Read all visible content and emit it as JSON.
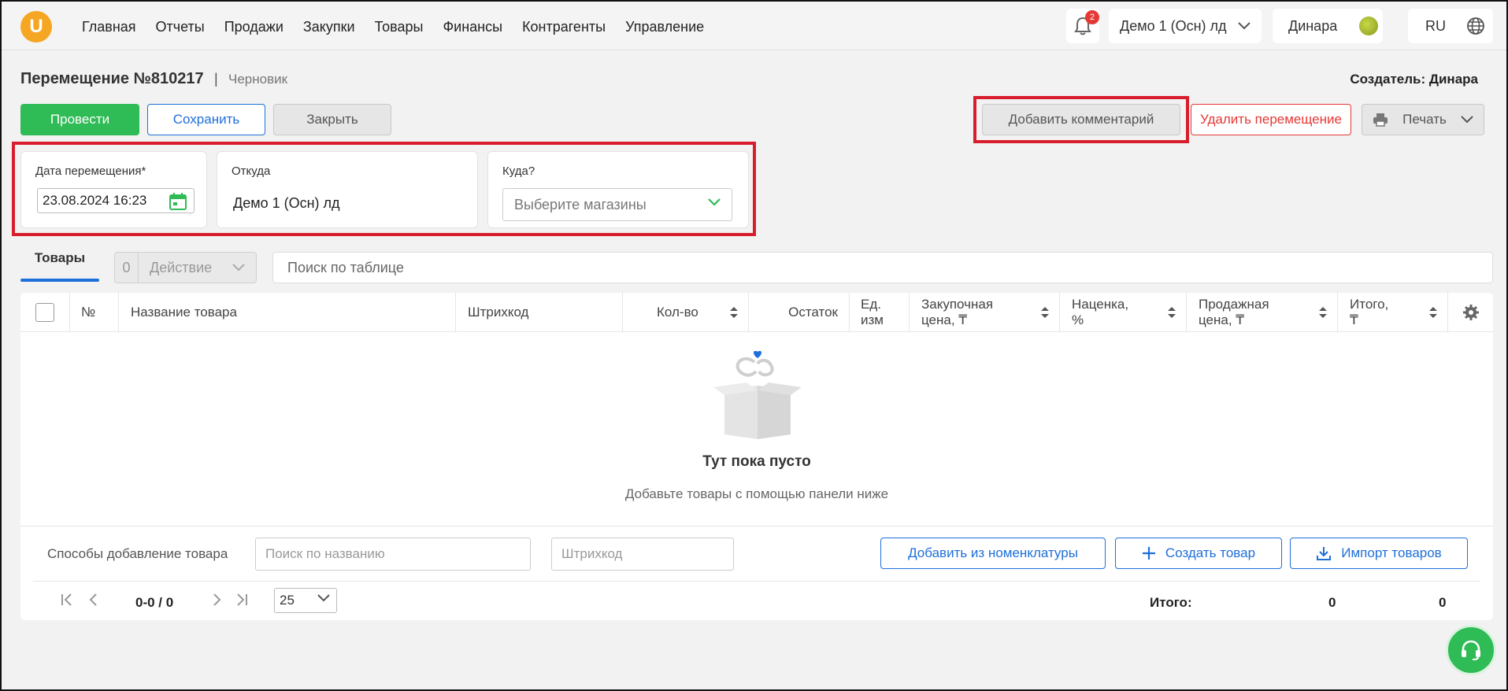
{
  "colors": {
    "accent": "#1e6fd9",
    "success": "#2fbb55",
    "danger": "#e53935",
    "highlight": "#d81e2c"
  },
  "nav": {
    "logo_letter": "U",
    "items": [
      "Главная",
      "Отчеты",
      "Продажи",
      "Закупки",
      "Товары",
      "Финансы",
      "Контрагенты",
      "Управление"
    ],
    "notifications_count": "2",
    "store": "Демо 1 (Осн) лд",
    "user": "Динара",
    "lang": "RU"
  },
  "doc": {
    "title": "Перемещение №810217",
    "separator": "|",
    "status": "Черновик",
    "creator": "Создатель: Динара"
  },
  "actions": {
    "post": "Провести",
    "save": "Сохранить",
    "close": "Закрыть",
    "comment": "Добавить комментарий",
    "delete": "Удалить перемещение",
    "print": "Печать"
  },
  "form": {
    "date_label": "Дата перемещения*",
    "date_value": "23.08.2024 16:23",
    "from_label": "Откуда",
    "from_value": "Демо 1 (Осн) лд",
    "to_label": "Куда?",
    "to_placeholder": "Выберите магазины"
  },
  "tabs": {
    "goods": "Товары",
    "action_count": "0",
    "action_label": "Действие",
    "search_placeholder": "Поиск по таблице"
  },
  "table": {
    "columns": {
      "num": "№",
      "name": "Название товара",
      "barcode": "Штрихкод",
      "qty": "Кол-во",
      "stock": "Остаток",
      "unit_1": "Ед.",
      "unit_2": "изм",
      "purchase_1": "Закупочная",
      "purchase_2": "цена, ₸",
      "markup_1": "Наценка,",
      "markup_2": "%",
      "sale_1": "Продажная",
      "sale_2": "цена, ₸",
      "total_1": "Итого,",
      "total_2": "₸"
    },
    "empty_title": "Тут пока пусто",
    "empty_subtitle": "Добавьте товары с помощью панели ниже"
  },
  "add_panel": {
    "label": "Способы добавление товара",
    "search_name_placeholder": "Поиск по названию",
    "barcode_placeholder": "Штрихкод",
    "from_catalog": "Добавить из номенклатуры",
    "create": "Создать товар",
    "import": "Импорт товаров"
  },
  "pager": {
    "range": "0-0 / 0",
    "page_size": "25",
    "total_label": "Итого:",
    "total_qty": "0",
    "total_sum": "0"
  }
}
